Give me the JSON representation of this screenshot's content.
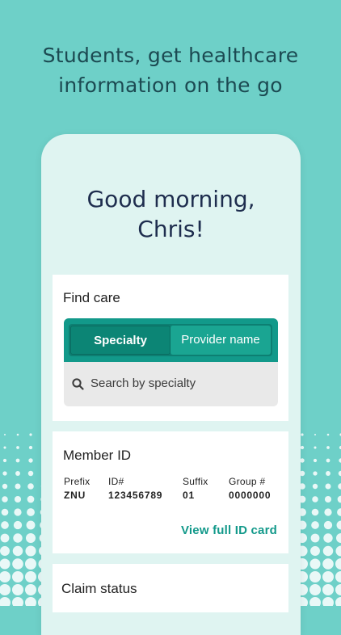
{
  "promo": {
    "headline_line1": "Students, get healthcare",
    "headline_line2": "information on the go"
  },
  "greeting": {
    "line1": "Good morning,",
    "line2": "Chris!"
  },
  "find_care": {
    "title": "Find care",
    "tabs": [
      {
        "label": "Specialty",
        "selected": true
      },
      {
        "label": "Provider name",
        "selected": false
      }
    ],
    "search_placeholder": "Search by specialty"
  },
  "member_id": {
    "title": "Member ID",
    "fields": [
      {
        "label": "Prefix",
        "value": "ZNU"
      },
      {
        "label": "ID#",
        "value": "123456789"
      },
      {
        "label": "Suffix",
        "value": "01"
      },
      {
        "label": "Group #",
        "value": "0000000"
      }
    ],
    "link_label": "View full ID card"
  },
  "claim_status": {
    "title": "Claim status"
  },
  "colors": {
    "background": "#6ed0c8",
    "accent": "#12998a",
    "headline_text": "#1c4a52",
    "greeting_text": "#1e2d4e"
  }
}
